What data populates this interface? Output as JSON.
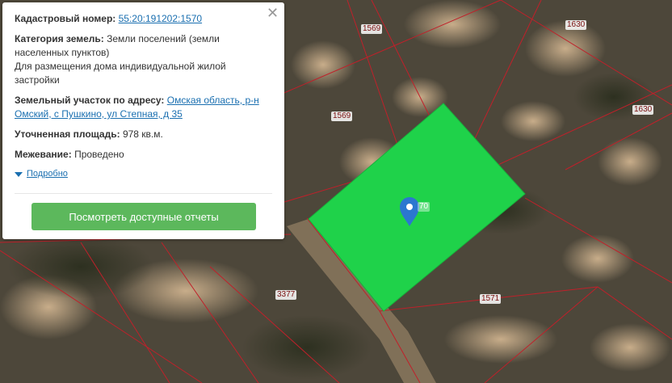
{
  "popup": {
    "cadastral_label": "Кадастровый номер:",
    "cadastral_value": "55:20:191202:1570",
    "category_label": "Категория земель:",
    "category_value": "Земли поселений (земли населенных пунктов)",
    "usage_value": "Для размещения дома индивидуальной жилой застройки",
    "address_label": "Земельный участок по адресу:",
    "address_value": "Омская область, р-н Омский, с Пушкино, ул Степная, д 35",
    "area_label": "Уточненная площадь:",
    "area_value": "978 кв.м.",
    "survey_label": "Межевание:",
    "survey_value": "Проведено",
    "details_link": "Подробно",
    "reports_button": "Посмотреть доступные отчеты",
    "close_glyph": "✕"
  },
  "map": {
    "parcel_labels": [
      "1569",
      "1630",
      "1569",
      "1630",
      "3377",
      "1571",
      "70"
    ],
    "highlight_color": "#1fd24a",
    "boundary_color": "#c0202a",
    "marker_color": "#2b77d0",
    "marker_icon": "map-pin-icon"
  }
}
